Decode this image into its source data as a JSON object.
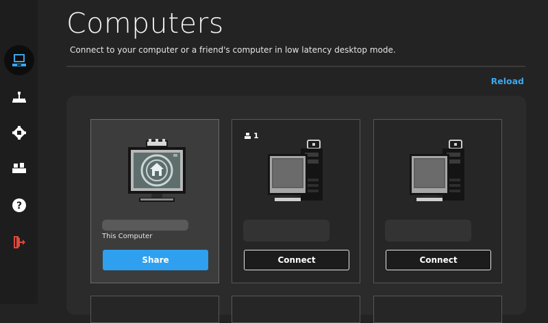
{
  "page": {
    "title": "Computers",
    "subtitle": "Connect to your computer or a friend's computer in low latency desktop mode.",
    "reload_label": "Reload"
  },
  "sidebar": {
    "items": [
      {
        "icon": "computer-icon",
        "active": true
      },
      {
        "icon": "joystick-icon",
        "active": false
      },
      {
        "icon": "gear-icon",
        "active": false
      },
      {
        "icon": "friends-icon",
        "active": false
      },
      {
        "icon": "help-icon",
        "active": false
      },
      {
        "icon": "logout-icon",
        "active": false
      }
    ]
  },
  "cards": [
    {
      "type": "self",
      "label": "This Computer",
      "button": "Share"
    },
    {
      "type": "friend",
      "users": "1",
      "button": "Connect"
    },
    {
      "type": "friend",
      "button": "Connect"
    }
  ],
  "colors": {
    "accent": "#2ea0ef",
    "link": "#3aa8ef",
    "logout": "#e0483c"
  }
}
